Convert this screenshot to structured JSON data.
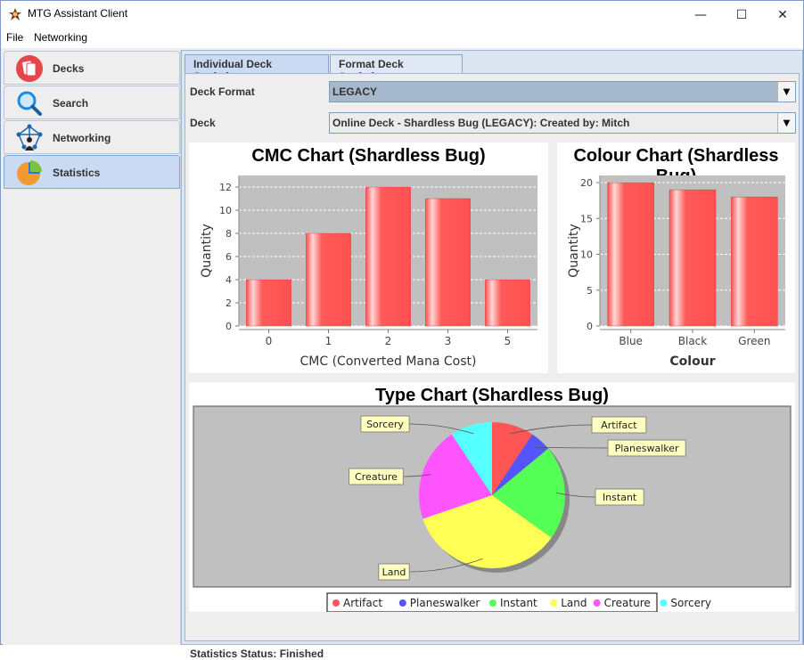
{
  "window": {
    "title": "MTG Assistant Client",
    "minimize": "—",
    "maximize": "☐",
    "close": "✕"
  },
  "menu": {
    "file": "File",
    "networking": "Networking"
  },
  "sidebar": {
    "items": [
      {
        "label": "Decks",
        "icon": "decks-icon"
      },
      {
        "label": "Search",
        "icon": "search-icon"
      },
      {
        "label": "Networking",
        "icon": "network-icon"
      },
      {
        "label": "Statistics",
        "icon": "pie-chart-icon",
        "active": true
      }
    ]
  },
  "tabs": [
    {
      "label": "Individual Deck Statistics",
      "active": true
    },
    {
      "label": "Format Deck Statistics"
    }
  ],
  "form": {
    "deck_format_label": "Deck Format",
    "deck_format_value": "LEGACY",
    "deck_label": "Deck",
    "deck_value": "Online Deck - Shardless Bug (LEGACY): Created by: Mitch"
  },
  "status": "Statistics Status: Finished",
  "colors": {
    "bar": "#ff5555",
    "plot_bg": "#c0c0c0",
    "accent": "#c9daf2"
  },
  "chart_data": [
    {
      "type": "bar",
      "title": "CMC Chart (Shardless Bug)",
      "categories": [
        "0",
        "1",
        "2",
        "3",
        "5"
      ],
      "values": [
        4,
        8,
        12,
        11,
        4
      ],
      "xlabel": "CMC (Converted Mana Cost)",
      "ylabel": "Quantity",
      "ylim": [
        0,
        13
      ],
      "yticks": [
        0,
        2,
        4,
        6,
        8,
        10,
        12
      ],
      "grid": true
    },
    {
      "type": "bar",
      "title": "Colour Chart (Shardless Bug)",
      "categories": [
        "Blue",
        "Black",
        "Green"
      ],
      "values": [
        20,
        19,
        18
      ],
      "xlabel": "Colour",
      "ylabel": "Quantity",
      "ylim": [
        0,
        21
      ],
      "yticks": [
        0,
        5,
        10,
        15,
        20
      ],
      "grid": true
    },
    {
      "type": "pie",
      "title": "Type Chart (Shardless Bug)",
      "labels": [
        "Artifact",
        "Planeswalker",
        "Instant",
        "Land",
        "Creature",
        "Sorcery"
      ],
      "values": [
        4,
        2,
        9,
        15,
        9,
        4
      ],
      "colors": [
        "#ff5555",
        "#5555ff",
        "#55ff55",
        "#ffff55",
        "#ff55ff",
        "#55ffff"
      ],
      "legend": "bottom"
    }
  ]
}
